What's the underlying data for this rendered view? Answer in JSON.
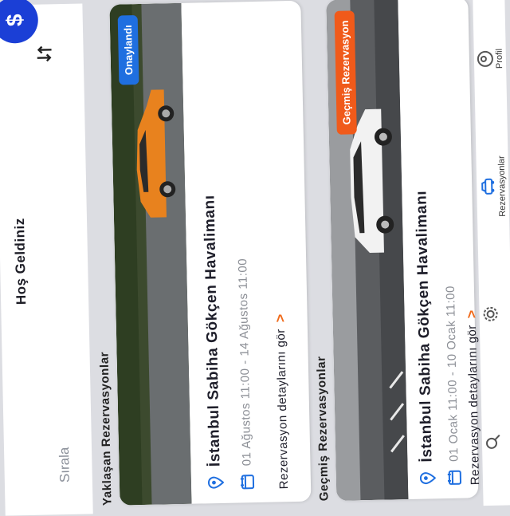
{
  "header": {
    "greeting": "Hoş Geldiniz",
    "sort_label": "Sırala",
    "currency_icon": "dollar-icon",
    "sort_icon": "sort-arrows-icon"
  },
  "sections": {
    "upcoming_title": "Yaklaşan Rezervasyonlar",
    "past_title": "Geçmiş Rezervasyonlar"
  },
  "upcoming_card": {
    "status": "Onaylandı",
    "location": "İstanbul Sabiha Gökçen Havalimanı",
    "dates": "01 Ağustos 11:00 - 14 Ağustos 11:00",
    "details_link": "Rezervasyon detaylarını gör",
    "car_color": "#e8821e"
  },
  "past_card": {
    "status": "Geçmiş Rezervasyon",
    "location": "İstanbul Sabiha Gökçen Havalimanı",
    "dates": "01 Ocak 11:00 - 10 Ocak 11:00",
    "details_link": "Rezervasyon detaylarını gör",
    "car_color": "#f2f2f2"
  },
  "nav": {
    "search_label": "",
    "settings_label": "",
    "reservations_label": "Rezervasyonlar",
    "profile_label": "Profil"
  },
  "colors": {
    "accent_blue": "#1f6fe0",
    "accent_orange": "#f05a1a"
  }
}
